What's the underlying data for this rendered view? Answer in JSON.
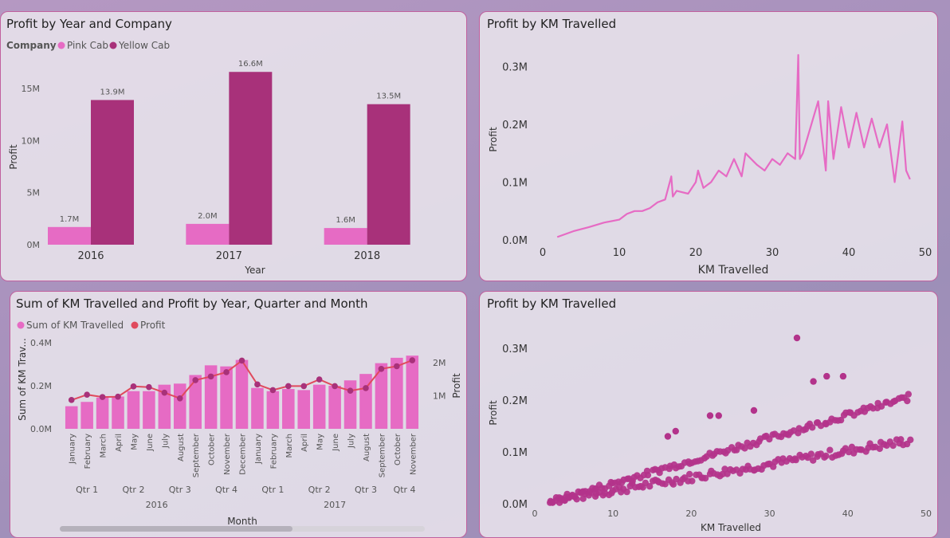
{
  "colors": {
    "pink": "#e66bc4",
    "yellow": "#a8317a",
    "profit_line": "#e04a5d",
    "scatter": "#b3338b"
  },
  "chart_data": [
    {
      "type": "bar",
      "title": "Profit by Year and Company",
      "legend_title": "Company",
      "categories": [
        "2016",
        "2017",
        "2018"
      ],
      "series": [
        {
          "name": "Pink Cab",
          "values": [
            1.7,
            2.0,
            1.6
          ],
          "labels": [
            "1.7M",
            "2.0M",
            "1.6M"
          ]
        },
        {
          "name": "Yellow Cab",
          "values": [
            13.9,
            16.6,
            13.5
          ],
          "labels": [
            "13.9M",
            "16.6M",
            "13.5M"
          ]
        }
      ],
      "xlabel": "Year",
      "ylabel": "Profit",
      "yticks": [
        "0M",
        "5M",
        "10M",
        "15M"
      ],
      "ytick_values": [
        0,
        5,
        10,
        15
      ],
      "ylim": [
        0,
        17
      ]
    },
    {
      "type": "line",
      "title": "Profit by KM Travelled",
      "xlabel": "KM Travelled",
      "ylabel": "Profit",
      "xlim": [
        0,
        50
      ],
      "ylim": [
        0,
        0.32
      ],
      "xticks": [
        "0",
        "10",
        "20",
        "30",
        "40",
        "50"
      ],
      "xtick_values": [
        0,
        10,
        20,
        30,
        40,
        50
      ],
      "yticks": [
        "0.0M",
        "0.1M",
        "0.2M",
        "0.3M"
      ],
      "ytick_values": [
        0,
        0.1,
        0.2,
        0.3
      ],
      "x": [
        1.9,
        4,
        6,
        8,
        10,
        11,
        12,
        13,
        14,
        15,
        16,
        16.8,
        17,
        17.5,
        19,
        20,
        20.3,
        21,
        22,
        23,
        24,
        25,
        26,
        26.5,
        28,
        29,
        30,
        31,
        32,
        33,
        33.4,
        33.6,
        34,
        36,
        37,
        37.3,
        38,
        39,
        40,
        41,
        42,
        43,
        44,
        45,
        46,
        47,
        47.5,
        48
      ],
      "y": [
        0.005,
        0.015,
        0.022,
        0.03,
        0.035,
        0.045,
        0.05,
        0.05,
        0.055,
        0.065,
        0.07,
        0.11,
        0.075,
        0.085,
        0.08,
        0.1,
        0.12,
        0.09,
        0.1,
        0.12,
        0.11,
        0.14,
        0.11,
        0.15,
        0.13,
        0.12,
        0.14,
        0.13,
        0.15,
        0.14,
        0.32,
        0.14,
        0.15,
        0.24,
        0.12,
        0.24,
        0.14,
        0.23,
        0.16,
        0.22,
        0.16,
        0.21,
        0.16,
        0.2,
        0.1,
        0.205,
        0.12,
        0.105
      ]
    },
    {
      "type": "bar",
      "title": "Sum of KM Travelled and Profit by Year, Quarter and Month",
      "legend": [
        "Sum of KM Travelled",
        "Profit"
      ],
      "xlabel": "Month",
      "ylabel_left": "Sum of KM Trav...",
      "ylabel_right": "Profit",
      "yticks_left": [
        "0.0M",
        "0.2M",
        "0.4M"
      ],
      "ytick_left_values": [
        0,
        0.2,
        0.4
      ],
      "yticks_right": [
        "1M",
        "2M"
      ],
      "ytick_right_values": [
        1,
        2
      ],
      "ylim_left": [
        0,
        0.4
      ],
      "ylim_right": [
        0,
        2.6
      ],
      "categories": [
        "January",
        "February",
        "March",
        "April",
        "May",
        "June",
        "July",
        "August",
        "September",
        "October",
        "November",
        "December",
        "January",
        "February",
        "March",
        "April",
        "May",
        "June",
        "July",
        "August",
        "September",
        "October",
        "November"
      ],
      "quarters": [
        {
          "label": "Qtr 1",
          "start": 0,
          "end": 2
        },
        {
          "label": "Qtr 2",
          "start": 3,
          "end": 5
        },
        {
          "label": "Qtr 3",
          "start": 6,
          "end": 8
        },
        {
          "label": "Qtr 4",
          "start": 9,
          "end": 11
        },
        {
          "label": "Qtr 1",
          "start": 12,
          "end": 14
        },
        {
          "label": "Qtr 2",
          "start": 15,
          "end": 17
        },
        {
          "label": "Qtr 3",
          "start": 18,
          "end": 20
        },
        {
          "label": "Qtr 4",
          "start": 21,
          "end": 22
        }
      ],
      "years": [
        {
          "label": "2016",
          "start": 0,
          "end": 11
        },
        {
          "label": "2017",
          "start": 12,
          "end": 22
        }
      ],
      "series": [
        {
          "name": "Sum of KM Travelled",
          "type": "bar",
          "values": [
            0.105,
            0.125,
            0.145,
            0.15,
            0.175,
            0.175,
            0.205,
            0.21,
            0.25,
            0.295,
            0.29,
            0.32,
            0.19,
            0.175,
            0.185,
            0.18,
            0.205,
            0.2,
            0.225,
            0.255,
            0.305,
            0.33,
            0.34
          ]
        },
        {
          "name": "Profit",
          "type": "line",
          "values": [
            0.87,
            1.03,
            0.96,
            0.97,
            1.28,
            1.26,
            1.09,
            0.92,
            1.47,
            1.58,
            1.71,
            2.06,
            1.34,
            1.17,
            1.29,
            1.29,
            1.49,
            1.29,
            1.15,
            1.23,
            1.81,
            1.89,
            2.07
          ]
        }
      ]
    },
    {
      "type": "scatter",
      "title": "Profit by KM Travelled",
      "xlabel": "KM Travelled",
      "ylabel": "Profit",
      "xlim": [
        0,
        50
      ],
      "ylim": [
        0,
        0.32
      ],
      "xticks": [
        "0",
        "10",
        "20",
        "30",
        "40",
        "50"
      ],
      "xtick_values": [
        0,
        10,
        20,
        30,
        40,
        50
      ],
      "yticks": [
        "0.0M",
        "0.1M",
        "0.2M",
        "0.3M"
      ],
      "ytick_values": [
        0,
        0.1,
        0.2,
        0.3
      ],
      "bands": [
        {
          "x_start": 2,
          "x_end": 48,
          "slope": 0.00255,
          "intercept": 0.0,
          "spread": 0.008
        },
        {
          "x_start": 2,
          "x_end": 48,
          "slope": 0.0044,
          "intercept": -0.005,
          "spread": 0.006
        }
      ],
      "outliers": [
        [
          33.5,
          0.32
        ],
        [
          35.6,
          0.236
        ],
        [
          37.3,
          0.246
        ],
        [
          39.4,
          0.246
        ],
        [
          22.4,
          0.17
        ],
        [
          23.5,
          0.17
        ],
        [
          28,
          0.18
        ],
        [
          17,
          0.13
        ],
        [
          18,
          0.14
        ]
      ]
    }
  ]
}
